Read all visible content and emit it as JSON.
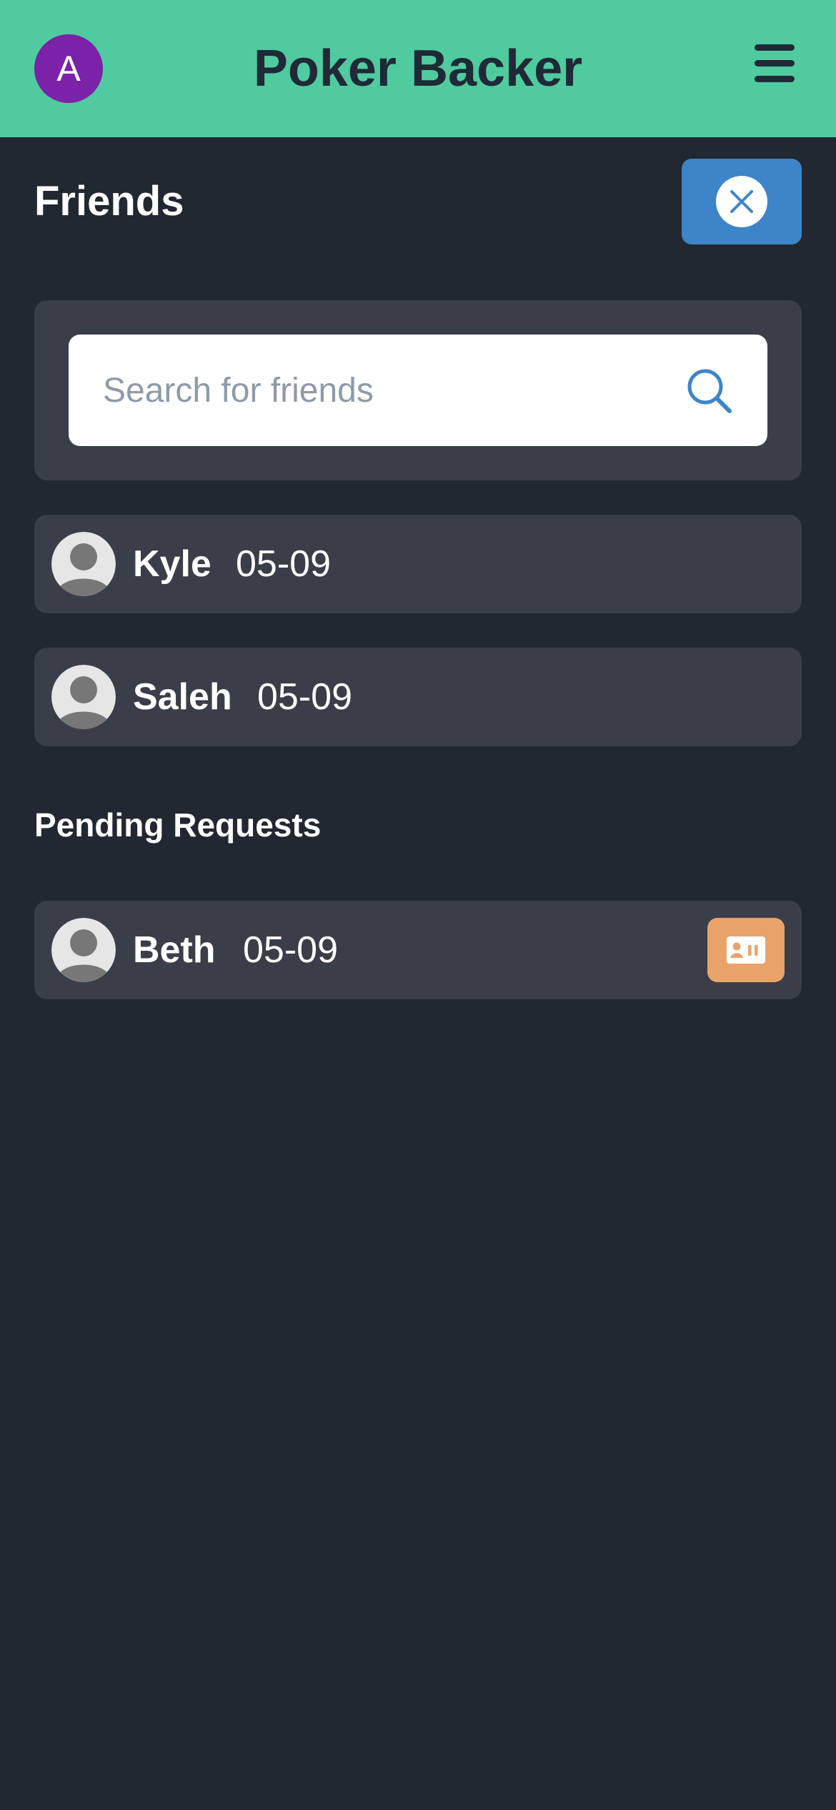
{
  "header": {
    "avatar_letter": "A",
    "title": "Poker Backer",
    "menu_icon": "hamburger-menu-icon"
  },
  "friends": {
    "title": "Friends",
    "close_icon": "close-icon",
    "search": {
      "placeholder": "Search for friends",
      "value": "",
      "icon": "search-icon"
    },
    "list": [
      {
        "name": "Kyle",
        "date": "05-09"
      },
      {
        "name": "Saleh",
        "date": "05-09"
      }
    ]
  },
  "pending": {
    "title": "Pending Requests",
    "list": [
      {
        "name": "Beth",
        "date": "05-09",
        "action_icon": "id-card-icon"
      }
    ]
  },
  "colors": {
    "header_bg": "#4fcb9f",
    "page_bg": "#222831",
    "card_bg": "#3a3e48",
    "avatar_bg": "#7b22a8",
    "close_button_bg": "#3d85c8",
    "accept_button_bg": "#e9a36a"
  }
}
